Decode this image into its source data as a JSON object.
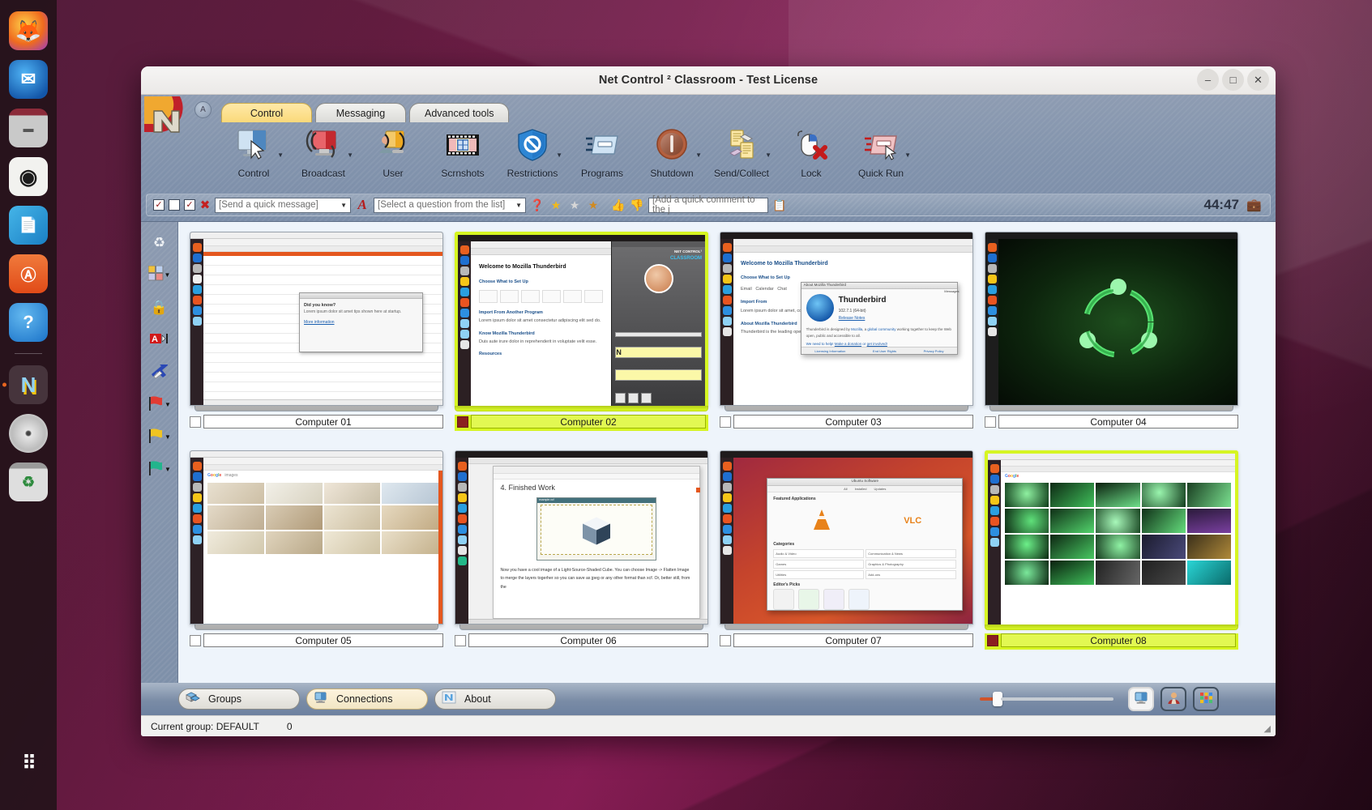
{
  "desktop": {
    "dock": {
      "items": [
        {
          "name": "firefox",
          "label": "Firefox",
          "icon": "firefox-icon",
          "color": "#e8601f",
          "glyph": "🦊"
        },
        {
          "name": "thunderbird",
          "label": "Thunderbird",
          "icon": "thunderbird-icon",
          "color": "#1f6fd0",
          "glyph": "✉"
        },
        {
          "name": "files",
          "label": "Files",
          "icon": "files-icon",
          "color": "#b8b8b8",
          "glyph": "📁"
        },
        {
          "name": "rhythmbox",
          "label": "Rhythmbox",
          "icon": "rhythmbox-icon",
          "color": "#f0f0f0",
          "glyph": "◉"
        },
        {
          "name": "libreoffice-impress",
          "label": "LibreOffice",
          "icon": "libreoffice-icon",
          "color": "#2a9fe0",
          "glyph": "📄"
        },
        {
          "name": "ubuntu-software",
          "label": "Ubuntu Software",
          "icon": "software-store-icon",
          "color": "#e95420",
          "glyph": "A"
        },
        {
          "name": "help",
          "label": "Help",
          "icon": "help-icon",
          "color": "#2d8fe0",
          "glyph": "?"
        },
        {
          "name": "netcontrol",
          "label": "Net Control 2",
          "icon": "netcontrol-icon",
          "color": "#f5c518",
          "glyph": "N"
        },
        {
          "name": "disc",
          "label": "CD/DVD",
          "icon": "optical-disc-icon",
          "color": "#d9d9d9",
          "glyph": "◎"
        },
        {
          "name": "trash",
          "label": "Trash",
          "icon": "trash-icon",
          "color": "#dcdcdc",
          "glyph": "♻"
        }
      ],
      "show_apps_label": "Show Applications"
    }
  },
  "window": {
    "title": "Net Control ² Classroom - Test License",
    "controls": {
      "minimize": "–",
      "maximize": "□",
      "close": "✕"
    }
  },
  "ribbon": {
    "app_button_label": "A",
    "tabs": [
      {
        "label": "Control",
        "selected": true
      },
      {
        "label": "Messaging",
        "selected": false
      },
      {
        "label": "Advanced tools",
        "selected": false
      }
    ],
    "buttons": [
      {
        "label": "Control",
        "icon": "monitor-cursor-icon",
        "dropdown": true
      },
      {
        "label": "Broadcast",
        "icon": "broadcast-screen-icon",
        "dropdown": true
      },
      {
        "label": "User",
        "icon": "user-broadcast-icon",
        "dropdown": false
      },
      {
        "label": "Scrnshots",
        "icon": "filmstrip-icon",
        "dropdown": false
      },
      {
        "label": "Restrictions",
        "icon": "blue-shield-block-icon",
        "dropdown": true
      },
      {
        "label": "Programs",
        "icon": "program-window-icon",
        "dropdown": false
      },
      {
        "label": "Shutdown",
        "icon": "power-icon",
        "dropdown": true
      },
      {
        "label": "Send/Collect",
        "icon": "documents-exchange-icon",
        "dropdown": true
      },
      {
        "label": "Lock",
        "icon": "mouse-lock-icon",
        "dropdown": false
      },
      {
        "label": "Quick Run",
        "icon": "quick-run-icon",
        "dropdown": true
      }
    ]
  },
  "quickbar": {
    "check1": {
      "icon": "checked-box-icon",
      "glyph": "✓",
      "checked": true
    },
    "check2": {
      "icon": "empty-box-icon",
      "glyph": "",
      "checked": false
    },
    "check3": {
      "icon": "checked-box-icon",
      "glyph": "✓",
      "checked": true
    },
    "check4": {
      "icon": "red-x-icon",
      "glyph": "✖",
      "checked": false
    },
    "quick_message_placeholder": "[Send a quick message]",
    "font_icon": "red-a-font-icon",
    "question_placeholder": "[Select a question from the list]",
    "help_icon": "orange-question-mark-icon",
    "star_gold_icon": "gold-star-icon",
    "star_silver_icon": "silver-star-icon",
    "star_bronze_icon": "bronze-star-icon",
    "thumb_up_icon": "thumb-up-icon",
    "thumb_down_icon": "thumb-down-icon",
    "comment_placeholder": "[Add a quick comment to the j",
    "journal_icon": "journal-icon",
    "timer": "44:47",
    "briefcase_icon": "briefcase-icon"
  },
  "sidebar": {
    "items": [
      {
        "name": "refresh-tool",
        "icon": "refresh-arrows-icon",
        "glyph": "♻",
        "color": "#e8e8e8",
        "dropdown": false
      },
      {
        "name": "color-marks-tool",
        "icon": "color-grid-icon",
        "glyph": "▒",
        "color": "#d88fa0",
        "dropdown": true
      },
      {
        "name": "lock-tool",
        "icon": "padlock-icon",
        "glyph": "🔒",
        "color": "#e8b830",
        "dropdown": false
      },
      {
        "name": "rename-tool",
        "icon": "rename-text-icon",
        "glyph": "A",
        "color": "#d02020",
        "dropdown": false
      },
      {
        "name": "connections-tool",
        "icon": "swap-arrows-icon",
        "glyph": "⤨",
        "color": "#2848b8",
        "dropdown": false
      },
      {
        "name": "flag-red-tool",
        "icon": "red-flag-icon",
        "glyph": "⚑",
        "color": "#e03030",
        "dropdown": true
      },
      {
        "name": "flag-yellow-tool",
        "icon": "yellow-flag-icon",
        "glyph": "⚑",
        "color": "#f0c020",
        "dropdown": true
      },
      {
        "name": "flag-green-tool",
        "icon": "green-flag-icon",
        "glyph": "⚑",
        "color": "#22b888",
        "dropdown": true
      }
    ]
  },
  "computers": [
    {
      "label": "Computer 01",
      "selected": false,
      "checked": false,
      "screen": "libreoffice-calc-tip-dialog"
    },
    {
      "label": "Computer 02",
      "selected": true,
      "checked": true,
      "screen": "thunderbird-welcome-netcontrol-client"
    },
    {
      "label": "Computer 03",
      "selected": false,
      "checked": false,
      "screen": "thunderbird-about-dialog"
    },
    {
      "label": "Computer 04",
      "selected": false,
      "checked": false,
      "screen": "ubuntu-green-wallpaper-terminal"
    },
    {
      "label": "Computer 05",
      "selected": false,
      "checked": false,
      "screen": "google-images-browser"
    },
    {
      "label": "Computer 06",
      "selected": false,
      "checked": false,
      "screen": "gimp-tutorial-finished-work"
    },
    {
      "label": "Computer 07",
      "selected": false,
      "checked": false,
      "screen": "ubuntu-software-vlc"
    },
    {
      "label": "Computer 08",
      "selected": true,
      "checked": true,
      "screen": "google-images-wallpapers"
    }
  ],
  "computer_06_screen": {
    "heading": "4. Finished Work",
    "body": "Now you have a cool image of a Light-Source-Shaded Cube. You can choose  Image -> Flatten Image to merge the layers togerher so you can save as jpeg or any other format than xcf. Or, better still, from the"
  },
  "footer": {
    "tabs": [
      {
        "label": "Groups",
        "icon": "groups-icon",
        "selected": false
      },
      {
        "label": "Connections",
        "icon": "connections-icon",
        "selected": true
      },
      {
        "label": "About",
        "icon": "about-n-icon",
        "selected": false
      }
    ],
    "zoom_slider": {
      "name": "thumbnail-size-slider",
      "value": 12
    },
    "view_buttons": [
      {
        "name": "view-thumbnails",
        "icon": "monitor-view-icon",
        "selected": true
      },
      {
        "name": "view-users",
        "icon": "user-view-icon",
        "selected": false
      },
      {
        "name": "view-tiles",
        "icon": "tiles-view-icon",
        "selected": false
      }
    ]
  },
  "statusbar": {
    "group_text": "Current group: DEFAULT",
    "count_text": "0",
    "grip_icon": "resize-grip-icon"
  }
}
